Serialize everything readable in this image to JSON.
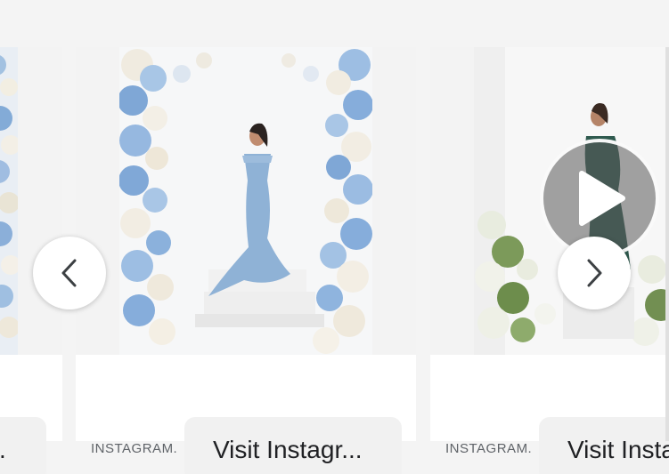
{
  "cards": [
    {
      "button_label": "…"
    },
    {
      "source": "INSTAGRAM.COM",
      "button_label": "Visit Instagr..."
    },
    {
      "source": "INSTAGRAM.COM",
      "button_label": "Visit Instagram"
    }
  ],
  "icons": {
    "prev": "chevron-left-icon",
    "next": "chevron-right-icon",
    "play": "play-icon"
  },
  "colors": {
    "page_bg": "#f4f4f4",
    "button_bg": "#f1f1f1",
    "source_text": "#5f6368"
  }
}
